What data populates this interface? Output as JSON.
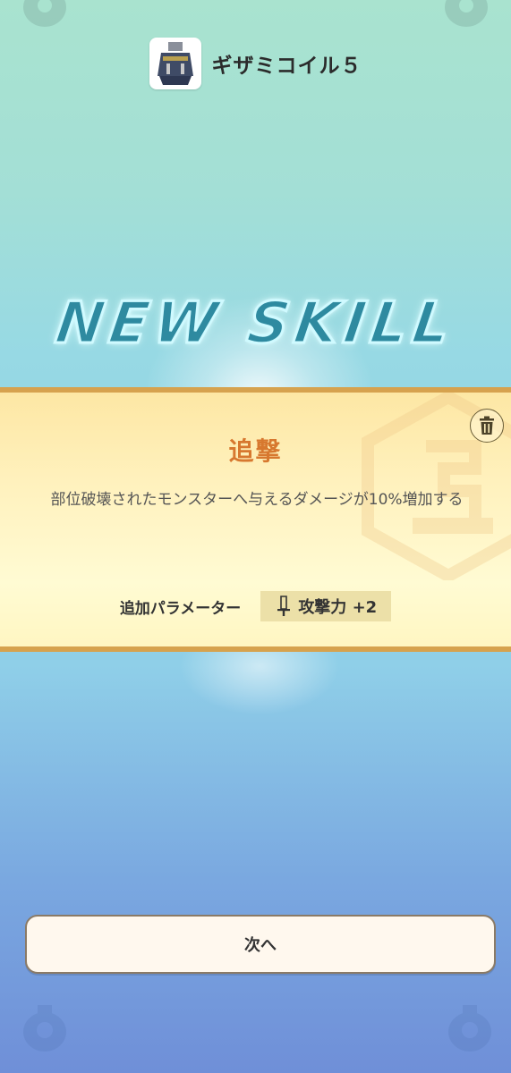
{
  "item": {
    "name": "ギザミコイル５",
    "icon": "armor-coil-icon"
  },
  "banner": {
    "title": "NEW SKILL"
  },
  "skill": {
    "name": "追撃",
    "description": "部位破壊されたモンスターへ与えるダメージが10%増加する",
    "param_label": "追加パラメーター",
    "param_value": "攻撃力 +2",
    "param_icon": "sword-icon"
  },
  "actions": {
    "next_label": "次へ",
    "delete_icon": "trash-icon"
  },
  "colors": {
    "accent": "#d7782f",
    "panel_border": "#d6a24e",
    "title_glow": "#cffaff"
  }
}
